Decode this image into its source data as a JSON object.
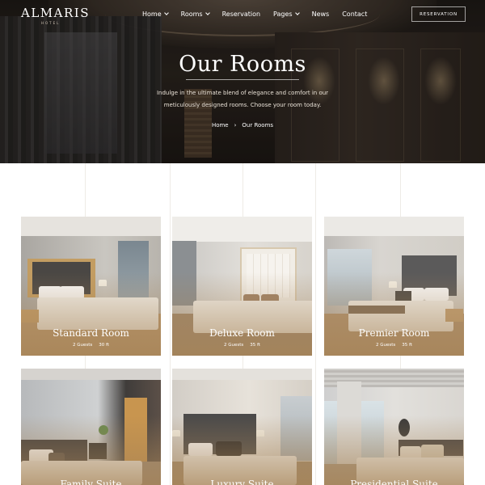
{
  "brand": {
    "name": "ALMARIS",
    "tagline": "HOTEL"
  },
  "nav": {
    "items": [
      {
        "label": "Home",
        "dropdown": true
      },
      {
        "label": "Rooms",
        "dropdown": true
      },
      {
        "label": "Reservation",
        "dropdown": false
      },
      {
        "label": "Pages",
        "dropdown": true
      },
      {
        "label": "News",
        "dropdown": false
      },
      {
        "label": "Contact",
        "dropdown": false
      }
    ],
    "cta_label": "RESERVATION"
  },
  "hero": {
    "title": "Our Rooms",
    "description": "Indulge in the ultimate blend of elegance and comfort in our meticulously designed rooms. Choose your room today.",
    "breadcrumb": {
      "home": "Home",
      "separator": "›",
      "current": "Our Rooms"
    }
  },
  "rooms": [
    {
      "name": "Standard Room",
      "guests": "2 Guests",
      "size": "30 ft"
    },
    {
      "name": "Deluxe Room",
      "guests": "2 Guests",
      "size": "35 ft"
    },
    {
      "name": "Premier Room",
      "guests": "2 Guests",
      "size": "35 ft"
    },
    {
      "name": "Family Suite",
      "guests": "",
      "size": ""
    },
    {
      "name": "Luxury Suite",
      "guests": "",
      "size": ""
    },
    {
      "name": "Presidential Suite",
      "guests": "",
      "size": ""
    }
  ],
  "colors": {
    "accent_overlay": "#a5825a",
    "hero_dark": "#1d1a16",
    "page_bg": "#ffffff"
  }
}
